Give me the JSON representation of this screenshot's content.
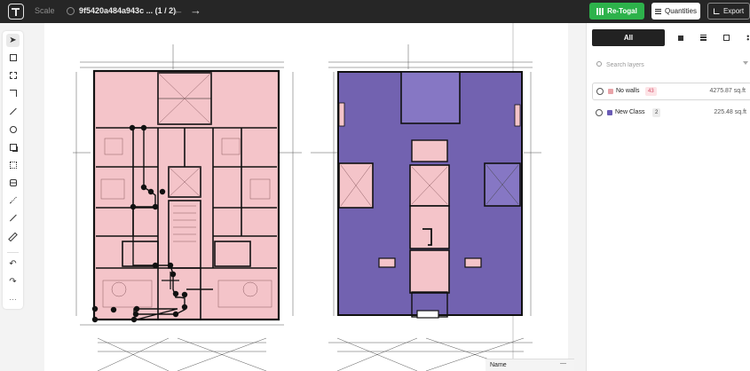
{
  "topbar": {
    "scale_label": "Scale",
    "file_name": "9f5420a484a943c ... (1 / 2)",
    "retogal_label": "Re-Togal",
    "quantities_label": "Quantities",
    "export_label": "Export"
  },
  "toolbar": {
    "tools": [
      "pointer-tool",
      "rectangle-tool",
      "polygon-tool",
      "crop-tool",
      "line-tool",
      "point-tool",
      "copy-tool",
      "paste-tool",
      "split-tool",
      "polyline-tool",
      "measure-tool",
      "ruler-tool",
      "undo-tool",
      "redo-tool",
      "more-tool"
    ]
  },
  "panel": {
    "filter_all": "All",
    "search_placeholder": "Search layers",
    "layers": [
      {
        "name": "No walls",
        "count": "43",
        "area": "4275.87 sq.ft",
        "color": "#e8a3a8",
        "count_bg": "#fde3e6",
        "count_color": "#d4506a"
      },
      {
        "name": "New Class",
        "count": "2",
        "area": "225.48 sq.ft",
        "color": "#6a5bb5",
        "count_bg": "#ececec",
        "count_color": "#444"
      }
    ]
  },
  "bottom": {
    "name_label": "Name",
    "name_value": "—"
  },
  "colors": {
    "room_fill": "#f4c4c9",
    "purple_fill": "#7262b0",
    "wall": "#111111",
    "green": "#2db24b"
  }
}
